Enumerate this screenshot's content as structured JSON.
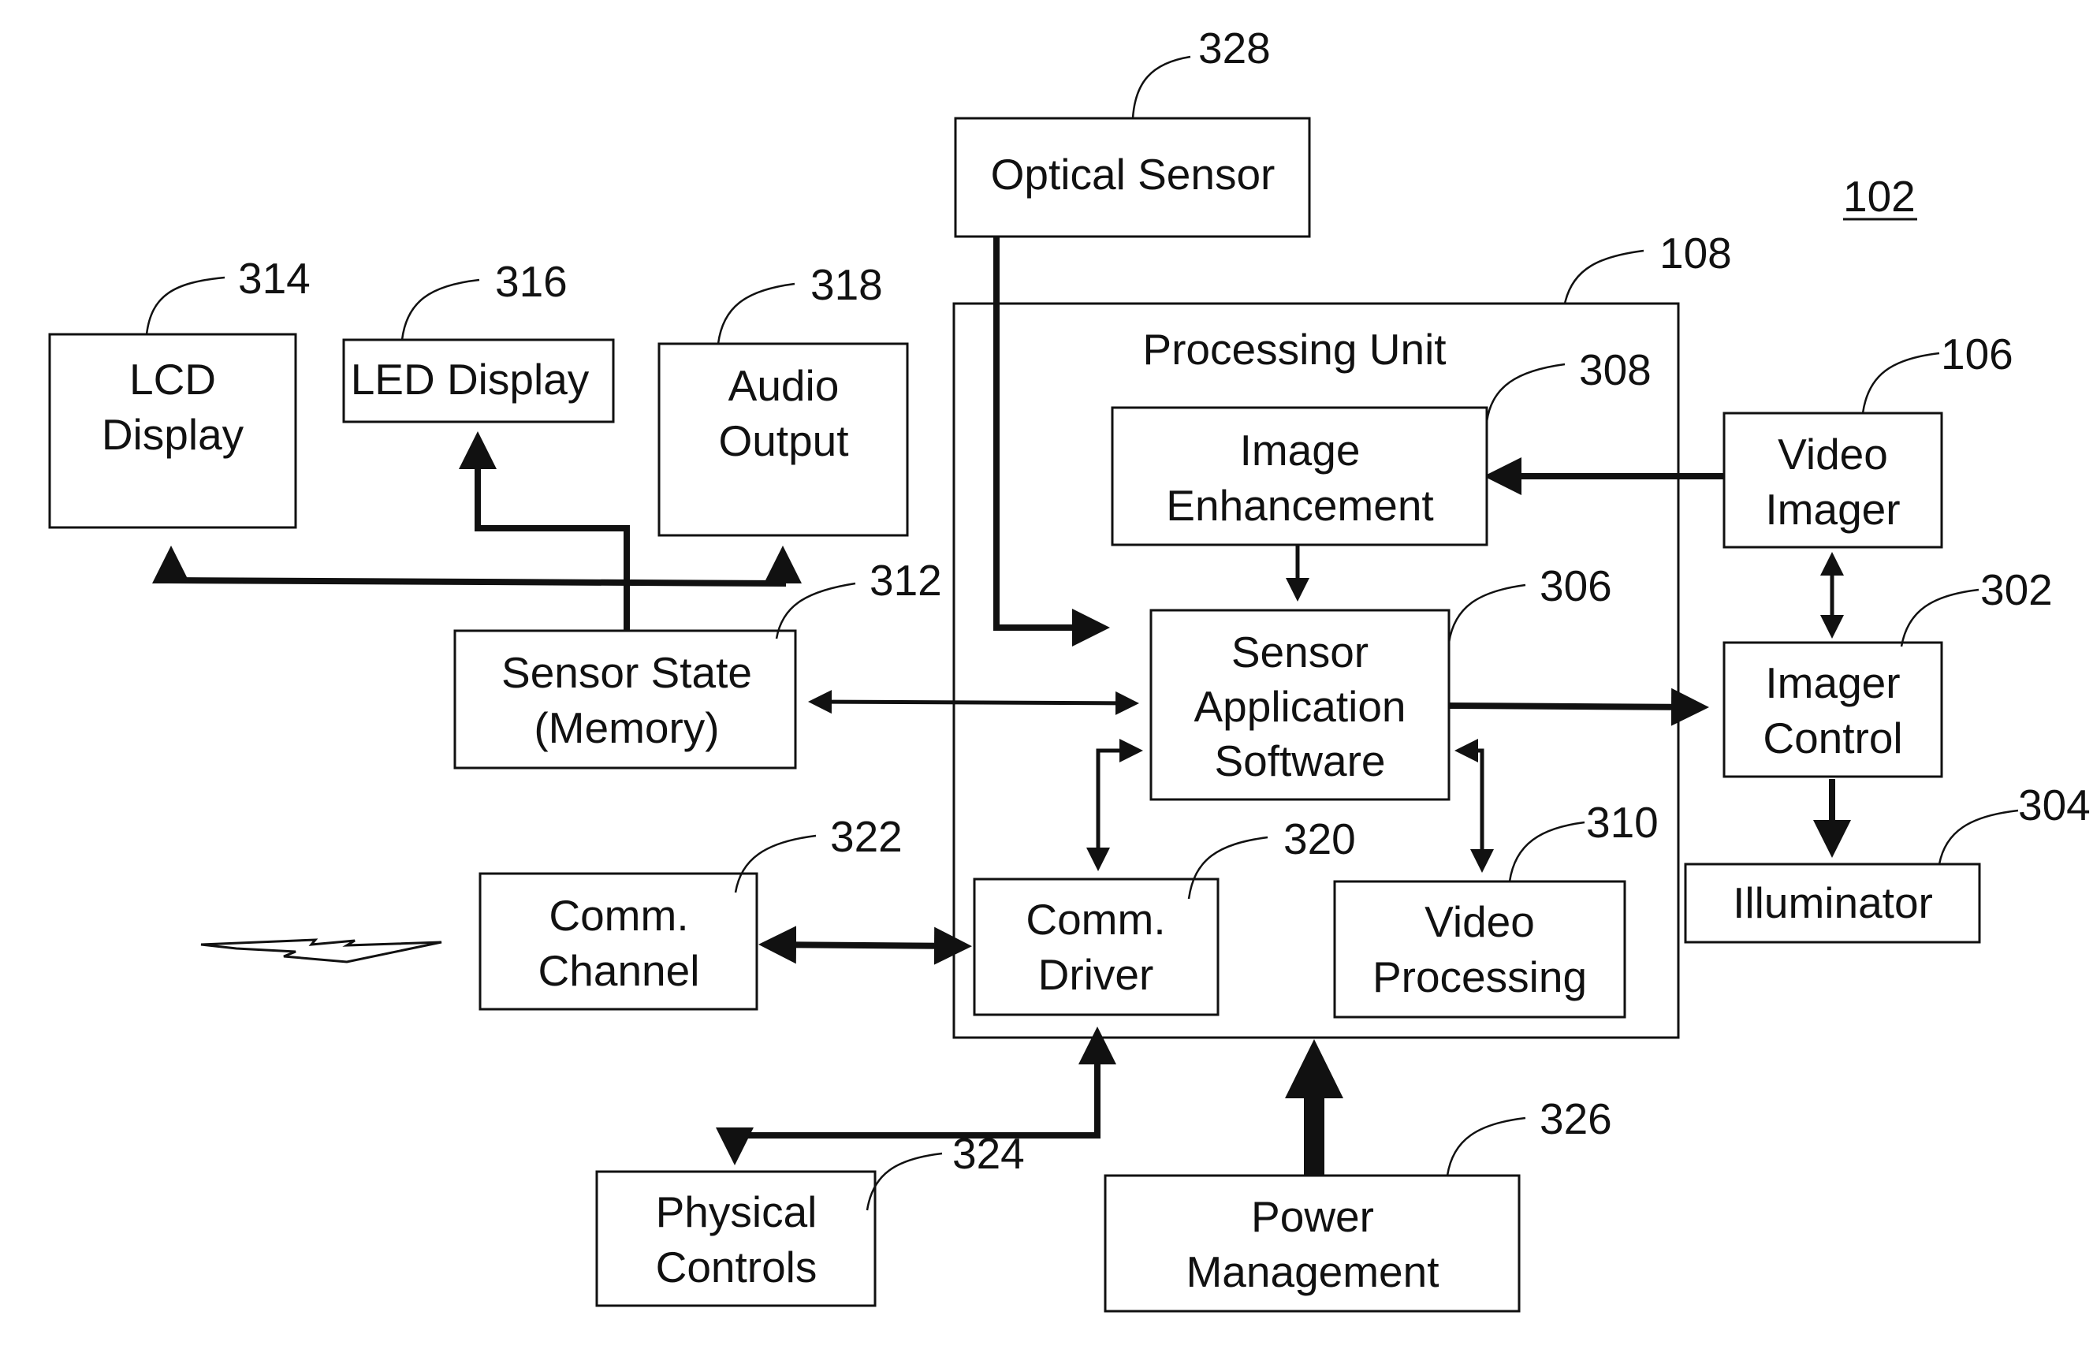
{
  "figure_ref": "102",
  "blocks": {
    "optical_sensor": {
      "ref": "328",
      "lines": [
        "Optical Sensor"
      ]
    },
    "processing_unit": {
      "ref": "108",
      "lines": [
        "Processing Unit"
      ]
    },
    "lcd_display": {
      "ref": "314",
      "lines": [
        "LCD",
        "Display"
      ]
    },
    "led_display": {
      "ref": "316",
      "lines": [
        "LED Display"
      ]
    },
    "audio_output": {
      "ref": "318",
      "lines": [
        "Audio",
        "Output"
      ]
    },
    "sensor_state": {
      "ref": "312",
      "lines": [
        "Sensor State",
        "(Memory)"
      ]
    },
    "image_enhancement": {
      "ref": "308",
      "lines": [
        "Image",
        "Enhancement"
      ]
    },
    "sensor_app": {
      "ref": "306",
      "lines": [
        "Sensor",
        "Application",
        "Software"
      ]
    },
    "video_imager": {
      "ref": "106",
      "lines": [
        "Video",
        "Imager"
      ]
    },
    "imager_control": {
      "ref": "302",
      "lines": [
        "Imager",
        "Control"
      ]
    },
    "illuminator": {
      "ref": "304",
      "lines": [
        "Illuminator"
      ]
    },
    "comm_channel": {
      "ref": "322",
      "lines": [
        "Comm.",
        "Channel"
      ]
    },
    "comm_driver": {
      "ref": "320",
      "lines": [
        "Comm.",
        "Driver"
      ]
    },
    "video_processing": {
      "ref": "310",
      "lines": [
        "Video",
        "Processing"
      ]
    },
    "physical_controls": {
      "ref": "324",
      "lines": [
        "Physical",
        "Controls"
      ]
    },
    "power_management": {
      "ref": "326",
      "lines": [
        "Power",
        "Management"
      ]
    }
  },
  "connections": [
    {
      "from": "optical_sensor",
      "to": "sensor_app",
      "direction": "one-way"
    },
    {
      "from": "video_imager",
      "to": "image_enhancement",
      "direction": "one-way"
    },
    {
      "from": "image_enhancement",
      "to": "sensor_app",
      "direction": "one-way"
    },
    {
      "from": "sensor_app",
      "to": "imager_control",
      "direction": "one-way"
    },
    {
      "from": "video_imager",
      "to": "imager_control",
      "direction": "two-way"
    },
    {
      "from": "imager_control",
      "to": "illuminator",
      "direction": "one-way"
    },
    {
      "from": "sensor_state",
      "to": "sensor_app",
      "direction": "two-way"
    },
    {
      "from": "sensor_state",
      "to": "lcd_display",
      "direction": "one-way"
    },
    {
      "from": "sensor_state",
      "to": "led_display",
      "direction": "one-way"
    },
    {
      "from": "sensor_state",
      "to": "audio_output",
      "direction": "one-way"
    },
    {
      "from": "sensor_app",
      "to": "comm_driver",
      "direction": "two-way"
    },
    {
      "from": "sensor_app",
      "to": "video_processing",
      "direction": "two-way"
    },
    {
      "from": "comm_channel",
      "to": "comm_driver",
      "direction": "two-way"
    },
    {
      "from": "comm_driver",
      "to": "physical_controls",
      "direction": "two-way"
    },
    {
      "from": "power_management",
      "to": "processing_unit",
      "direction": "one-way"
    }
  ]
}
